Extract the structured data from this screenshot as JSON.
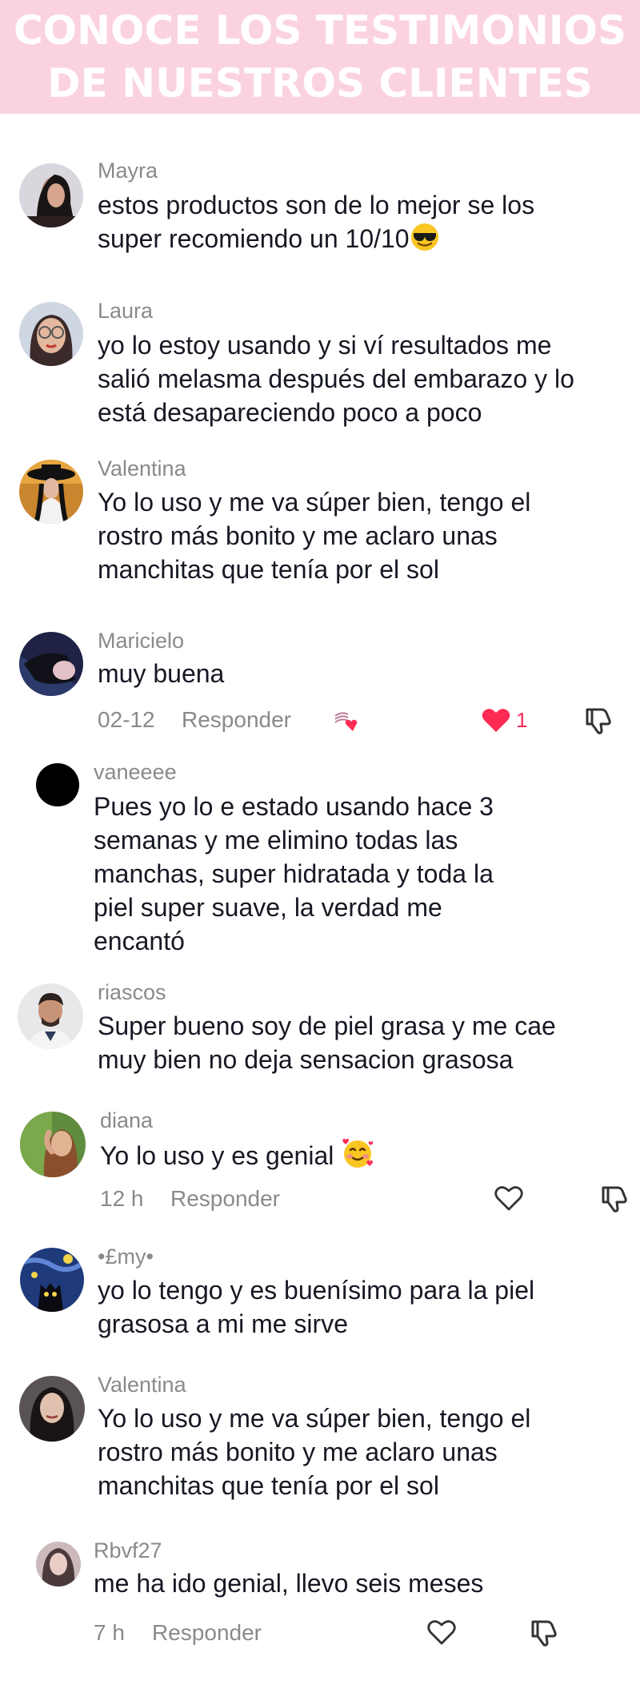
{
  "banner": {
    "line1": "CONOCE LOS TESTIMONIOS",
    "line2": "DE NUESTROS CLIENTES",
    "background": "#fbd3de"
  },
  "comments": [
    {
      "author": "Mayra",
      "lines": [
        "estos productos son de lo mejor se los",
        "super recomiendo un 10/10"
      ],
      "emoji": "sunglasses-face-emoji"
    },
    {
      "author": "Laura",
      "lines": [
        "yo lo estoy usando y si ví resultados me",
        "salió melasma después del embarazo y lo",
        "está desapareciendo poco a poco"
      ]
    },
    {
      "author": "Valentina",
      "lines": [
        "Yo lo uso y me va súper bien, tengo el",
        "rostro más bonito y me aclaro unas",
        "manchitas que tenía por el sol"
      ]
    },
    {
      "author": "Maricielo",
      "lines": [
        "muy buena"
      ],
      "time": "02-12",
      "reply": "Responder",
      "likes": "1",
      "liked": true
    },
    {
      "author": "vaneeee",
      "lines": [
        "Pues yo lo e estado usando hace 3",
        "semanas y me elimino todas las",
        "manchas, super hidratada y toda la",
        "piel super suave, la verdad me",
        "encantó"
      ]
    },
    {
      "author": "riascos",
      "lines": [
        "Super bueno soy de piel grasa y me cae",
        "muy bien no deja sensacion grasosa"
      ]
    },
    {
      "author": "diana",
      "lines": [
        "Yo lo uso y es genial"
      ],
      "emoji": "smiling-face-with-hearts-emoji",
      "time": "12 h",
      "reply": "Responder"
    },
    {
      "author": "•£my•",
      "lines": [
        "yo lo tengo y es buenísimo para la piel",
        "grasosa a mi me sirve"
      ]
    },
    {
      "author": "Valentina",
      "lines": [
        "Yo lo uso y me va súper bien, tengo el",
        "rostro más bonito y me aclaro unas",
        "manchitas que tenía por el sol"
      ]
    },
    {
      "author": "Rbvf27",
      "lines": [
        "me ha ido genial, llevo seis meses"
      ],
      "time": "7 h",
      "reply": "Responder"
    }
  ],
  "colors": {
    "author": "#8a8a8a",
    "text": "#161823",
    "like": "#fe2c55"
  }
}
